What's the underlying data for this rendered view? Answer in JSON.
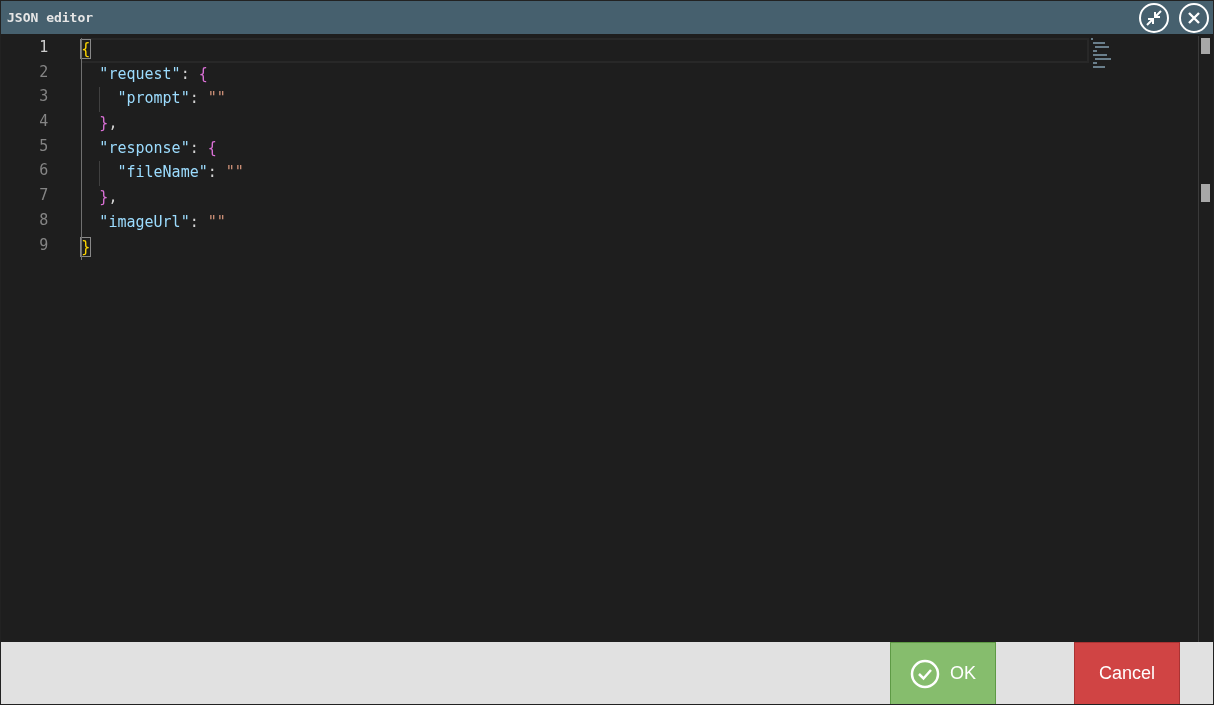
{
  "window": {
    "title": "JSON editor"
  },
  "editor": {
    "lines": [
      {
        "number": "1",
        "current": true,
        "tokens": [
          {
            "text": "{",
            "kind": "bracket-outer",
            "matched": true
          }
        ]
      },
      {
        "number": "2",
        "current": false,
        "tokens": [
          {
            "text": "  \"request\"",
            "kind": "key"
          },
          {
            "text": ": ",
            "kind": "punct"
          },
          {
            "text": "{",
            "kind": "bracket-inner",
            "matched": false
          }
        ]
      },
      {
        "number": "3",
        "current": false,
        "tokens": [
          {
            "text": "    \"prompt\"",
            "kind": "key"
          },
          {
            "text": ": ",
            "kind": "punct"
          },
          {
            "text": "\"\"",
            "kind": "string"
          }
        ]
      },
      {
        "number": "4",
        "current": false,
        "tokens": [
          {
            "text": "  }",
            "kind": "bracket-inner",
            "matched": false
          },
          {
            "text": ",",
            "kind": "punct"
          }
        ]
      },
      {
        "number": "5",
        "current": false,
        "tokens": [
          {
            "text": "  \"response\"",
            "kind": "key"
          },
          {
            "text": ": ",
            "kind": "punct"
          },
          {
            "text": "{",
            "kind": "bracket-inner",
            "matched": false
          }
        ]
      },
      {
        "number": "6",
        "current": false,
        "tokens": [
          {
            "text": "    \"fileName\"",
            "kind": "key"
          },
          {
            "text": ": ",
            "kind": "punct"
          },
          {
            "text": "\"\"",
            "kind": "string"
          }
        ]
      },
      {
        "number": "7",
        "current": false,
        "tokens": [
          {
            "text": "  }",
            "kind": "bracket-inner",
            "matched": false
          },
          {
            "text": ",",
            "kind": "punct"
          }
        ]
      },
      {
        "number": "8",
        "current": false,
        "tokens": [
          {
            "text": "  \"imageUrl\"",
            "kind": "key"
          },
          {
            "text": ": ",
            "kind": "punct"
          },
          {
            "text": "\"\"",
            "kind": "string"
          }
        ]
      },
      {
        "number": "9",
        "current": false,
        "tokens": [
          {
            "text": "}",
            "kind": "bracket-outer",
            "matched": true
          }
        ]
      }
    ]
  },
  "buttons": [
    {
      "label": "OK",
      "kind": "ok"
    },
    {
      "label": "Cancel",
      "kind": "cancel"
    }
  ]
}
